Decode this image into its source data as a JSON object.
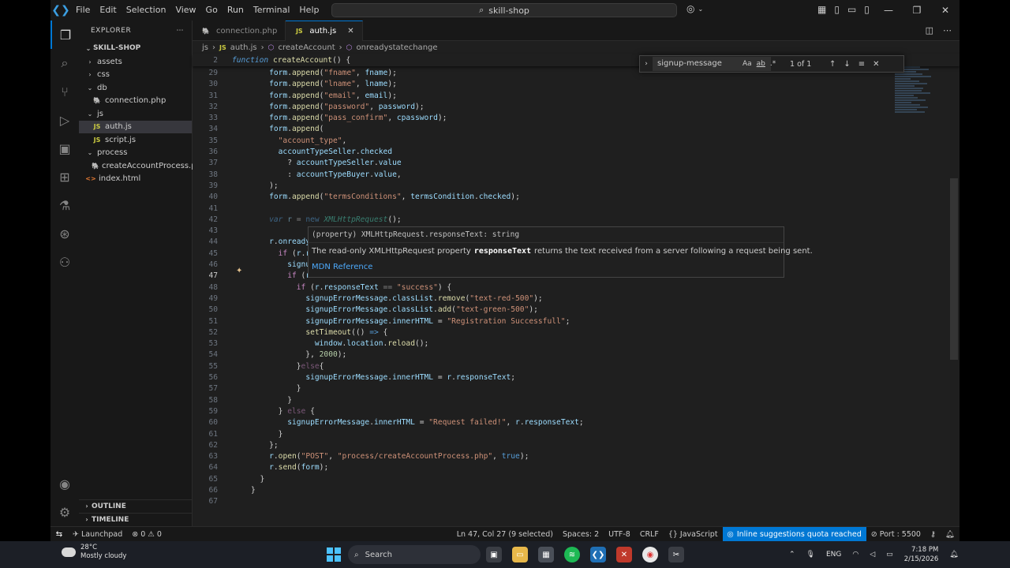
{
  "titlebar": {
    "menu": [
      "File",
      "Edit",
      "Selection",
      "View",
      "Go",
      "Run",
      "Terminal",
      "Help"
    ],
    "search_text": "skill-shop"
  },
  "sidebar": {
    "title": "EXPLORER",
    "root": "SKILL-SHOP",
    "tree": [
      {
        "label": "assets",
        "type": "folder",
        "depth": 1,
        "open": false
      },
      {
        "label": "css",
        "type": "folder",
        "depth": 1,
        "open": false
      },
      {
        "label": "db",
        "type": "folder",
        "depth": 1,
        "open": true
      },
      {
        "label": "connection.php",
        "type": "php",
        "depth": 2
      },
      {
        "label": "js",
        "type": "folder",
        "depth": 1,
        "open": true
      },
      {
        "label": "auth.js",
        "type": "js",
        "depth": 2,
        "selected": true
      },
      {
        "label": "script.js",
        "type": "js",
        "depth": 2
      },
      {
        "label": "process",
        "type": "folder",
        "depth": 1,
        "open": true
      },
      {
        "label": "createAccountProcess.php",
        "type": "php",
        "depth": 2
      },
      {
        "label": "index.html",
        "type": "html",
        "depth": 1
      }
    ],
    "outline": "OUTLINE",
    "timeline": "TIMELINE"
  },
  "tabs": [
    {
      "label": "connection.php",
      "type": "php",
      "active": false
    },
    {
      "label": "auth.js",
      "type": "js",
      "active": true
    }
  ],
  "breadcrumb": [
    "js",
    "auth.js",
    "createAccount",
    "onreadystatechange"
  ],
  "sticky": {
    "line": "2",
    "code": "function createAccount() {"
  },
  "code_lines": [
    {
      "n": "29",
      "html": "    <span class='v'>form</span>.<span class='f'>append</span>(<span class='s'>\"fname\"</span>, <span class='v'>fname</span>);"
    },
    {
      "n": "30",
      "html": "    <span class='v'>form</span>.<span class='f'>append</span>(<span class='s'>\"lname\"</span>, <span class='v'>lname</span>);"
    },
    {
      "n": "31",
      "html": "    <span class='v'>form</span>.<span class='f'>append</span>(<span class='s'>\"email\"</span>, <span class='v'>email</span>);"
    },
    {
      "n": "32",
      "html": "    <span class='v'>form</span>.<span class='f'>append</span>(<span class='s'>\"password\"</span>, <span class='v'>password</span>);"
    },
    {
      "n": "33",
      "html": "    <span class='v'>form</span>.<span class='f'>append</span>(<span class='s'>\"pass_confirm\"</span>, <span class='v'>cpassword</span>);"
    },
    {
      "n": "34",
      "html": "    <span class='v'>form</span>.<span class='f'>append</span>("
    },
    {
      "n": "35",
      "html": "      <span class='s'>\"account_type\"</span>,"
    },
    {
      "n": "36",
      "html": "      <span class='v'>accountTypeSeller</span>.<span class='v'>checked</span>"
    },
    {
      "n": "37",
      "html": "        ? <span class='v'>accountTypeSeller</span>.<span class='v'>value</span>"
    },
    {
      "n": "38",
      "html": "        : <span class='v'>accountTypeBuyer</span>.<span class='v'>value</span>,"
    },
    {
      "n": "39",
      "html": "    );"
    },
    {
      "n": "40",
      "html": "    <span class='v'>form</span>.<span class='f'>append</span>(<span class='s'>\"termsConditions\"</span>, <span class='v'>termsCondition</span>.<span class='v'>checked</span>);"
    },
    {
      "n": "41",
      "html": ""
    },
    {
      "n": "42",
      "html": "    <span class='k it dim'>var</span> <span class='v dim'>r</span> <span class='dim'>=</span> <span class='k dim'>new</span> <span class='c it dim'>XMLHttpRequest</span>();"
    },
    {
      "n": "43",
      "html": ""
    },
    {
      "n": "44",
      "html": "    <span class='v'>r</span>.<span class='v'>onreadysta</span>"
    },
    {
      "n": "45",
      "html": "      <span class='kc'>if</span> (<span class='v'>r</span>.<span class='v'>read</span>"
    },
    {
      "n": "46",
      "html": "        <span class='v'>signupEr</span>"
    },
    {
      "n": "47",
      "html": "        <span class='kc'>if</span> (<span class='v'>r</span>.<span class='v'>st</span>",
      "current": true
    },
    {
      "n": "48",
      "html": "          <span class='kc'>if</span> (<span class='v'>r</span>.<span class='v'>responseText</span> <span class='dim'>==</span> <span class='s'>\"success\"</span>) {"
    },
    {
      "n": "49",
      "html": "            <span class='v'>signupErrorMessage</span>.<span class='v'>classList</span>.<span class='f'>remove</span>(<span class='s'>\"text-red-500\"</span>);"
    },
    {
      "n": "50",
      "html": "            <span class='v'>signupErrorMessage</span>.<span class='v'>classList</span>.<span class='f'>add</span>(<span class='s'>\"text-green-500\"</span>);"
    },
    {
      "n": "51",
      "html": "            <span class='v'>signupErrorMessage</span>.<span class='v'>innerHTML</span> = <span class='s'>\"Registration Successfull\"</span>;"
    },
    {
      "n": "52",
      "html": "            <span class='f'>setTimeout</span>(() <span class='k'>=&gt;</span> {"
    },
    {
      "n": "53",
      "html": "              <span class='v'>window</span>.<span class='v'>location</span>.<span class='f'>reload</span>();"
    },
    {
      "n": "54",
      "html": "            }, <span class='n'>2000</span>);"
    },
    {
      "n": "55",
      "html": "          }<span class='kc dim'>else</span>{"
    },
    {
      "n": "56",
      "html": "            <span class='v'>signupErrorMessage</span>.<span class='v'>innerHTML</span> = <span class='v'>r</span>.<span class='v'>responseText</span>;"
    },
    {
      "n": "57",
      "html": "          }"
    },
    {
      "n": "58",
      "html": "        }"
    },
    {
      "n": "59",
      "html": "      } <span class='kc dim'>else</span> {"
    },
    {
      "n": "60",
      "html": "        <span class='v'>signupErrorMessage</span>.<span class='v'>innerHTML</span> = <span class='s'>\"Request failed!\"</span>, <span class='v'>r</span>.<span class='v'>responseText</span>;"
    },
    {
      "n": "61",
      "html": "      }"
    },
    {
      "n": "62",
      "html": "    };"
    },
    {
      "n": "63",
      "html": "    <span class='v'>r</span>.<span class='f'>open</span>(<span class='s'>\"POST\"</span>, <span class='s'>\"process/createAccountProcess.php\"</span>, <span class='k'>true</span>);"
    },
    {
      "n": "64",
      "html": "    <span class='v'>r</span>.<span class='f'>send</span>(<span class='v'>form</span>);"
    },
    {
      "n": "65",
      "html": "  }"
    },
    {
      "n": "66",
      "html": "}"
    },
    {
      "n": "67",
      "html": ""
    }
  ],
  "find": {
    "value": "signup-message",
    "count": "1 of 1",
    "opt_case": "Aa",
    "opt_word": "ab",
    "opt_regex": ".*"
  },
  "hover": {
    "signature": "(property) XMLHttpRequest.responseText: string",
    "desc_before": "The read-only XMLHttpRequest property",
    "desc_code": "responseText",
    "desc_after": "returns the text received from a server following a request being sent.",
    "link": "MDN Reference"
  },
  "statusbar": {
    "launchpad": "Launchpad",
    "errors": "0",
    "warnings": "0",
    "position": "Ln 47, Col 27 (9 selected)",
    "spaces": "Spaces: 2",
    "encoding": "UTF-8",
    "eol": "CRLF",
    "language": "JavaScript",
    "inline_warning": "Inline suggestions quota reached",
    "port": "Port : 5500"
  },
  "taskbar": {
    "temp": "28°C",
    "weather": "Mostly cloudy",
    "search": "Search",
    "lang": "ENG",
    "time": "7:18 PM",
    "date": "2/15/2026"
  },
  "colors": {
    "accent": "#0078d4",
    "editor_bg": "#1f1f1f",
    "sidebar_bg": "#181818"
  }
}
